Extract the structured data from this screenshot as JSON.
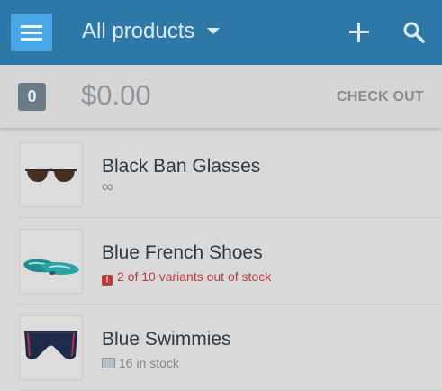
{
  "header": {
    "title": "All products",
    "menu_icon": "menu-icon",
    "add_icon": "plus-icon",
    "search_icon": "search-icon"
  },
  "cart": {
    "count": "0",
    "total": "$0.00",
    "checkout_label": "CHECK OUT"
  },
  "products": [
    {
      "name": "Black Ban Glasses",
      "status": "∞",
      "status_icon": "infinity"
    },
    {
      "name": "Blue French Shoes",
      "status": "2 of 10 variants out of stock",
      "status_icon": "warning-icon",
      "status_color": "#c23b3b"
    },
    {
      "name": "Blue Swimmies",
      "status": "16 in stock",
      "status_icon": "stock-icon"
    }
  ],
  "colors": {
    "appbar": "#2e78a8",
    "accent": "#4aa6e6",
    "warning": "#c23b3b"
  }
}
